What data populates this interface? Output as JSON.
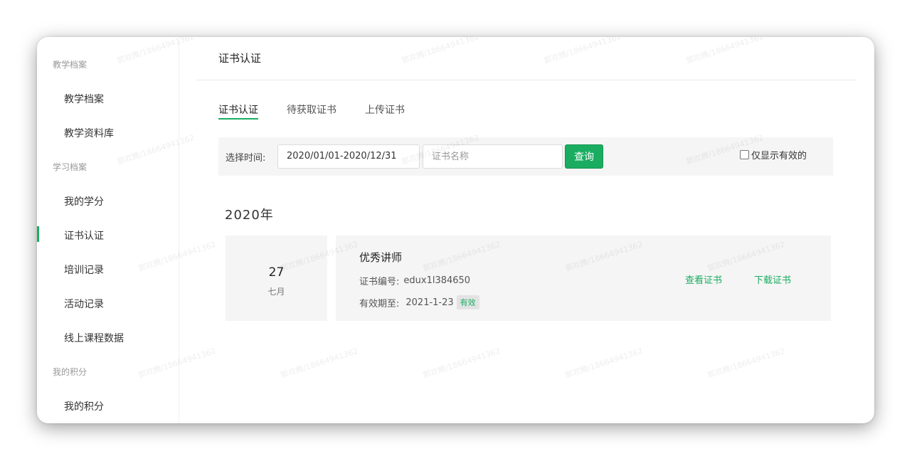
{
  "sidebar": {
    "groups": [
      {
        "title": "教学档案",
        "items": [
          "教学档案",
          "教学资料库"
        ]
      },
      {
        "title": "学习档案",
        "items": [
          "我的学分",
          "证书认证",
          "培训记录",
          "活动记录",
          "线上课程数据"
        ]
      },
      {
        "title": "我的积分",
        "items": [
          "我的积分"
        ]
      }
    ],
    "active_item": "证书认证"
  },
  "page": {
    "title": "证书认证"
  },
  "tabs": [
    {
      "label": "证书认证",
      "active": true
    },
    {
      "label": "待获取证书",
      "active": false
    },
    {
      "label": "上传证书",
      "active": false
    }
  ],
  "filter": {
    "time_label": "选择时间:",
    "date_range": "2020/01/01-2020/12/31",
    "name_placeholder": "证书名称",
    "query_label": "查询",
    "valid_only_label": "仅显示有效的",
    "valid_only_checked": false
  },
  "timeline": {
    "year": "2020年",
    "entries": [
      {
        "day": "27",
        "month": "七月",
        "name": "优秀讲师",
        "number_label": "证书编号:",
        "number": "edux1l384650",
        "expiry_label": "有效期至:",
        "expiry": "2021-1-23",
        "status": "有效",
        "view_label": "查看证书",
        "download_label": "下载证书"
      }
    ]
  },
  "watermark_text": "郭欢腾/18664941362",
  "colors": {
    "accent": "#1aad61",
    "panel": "#f5f5f5"
  }
}
